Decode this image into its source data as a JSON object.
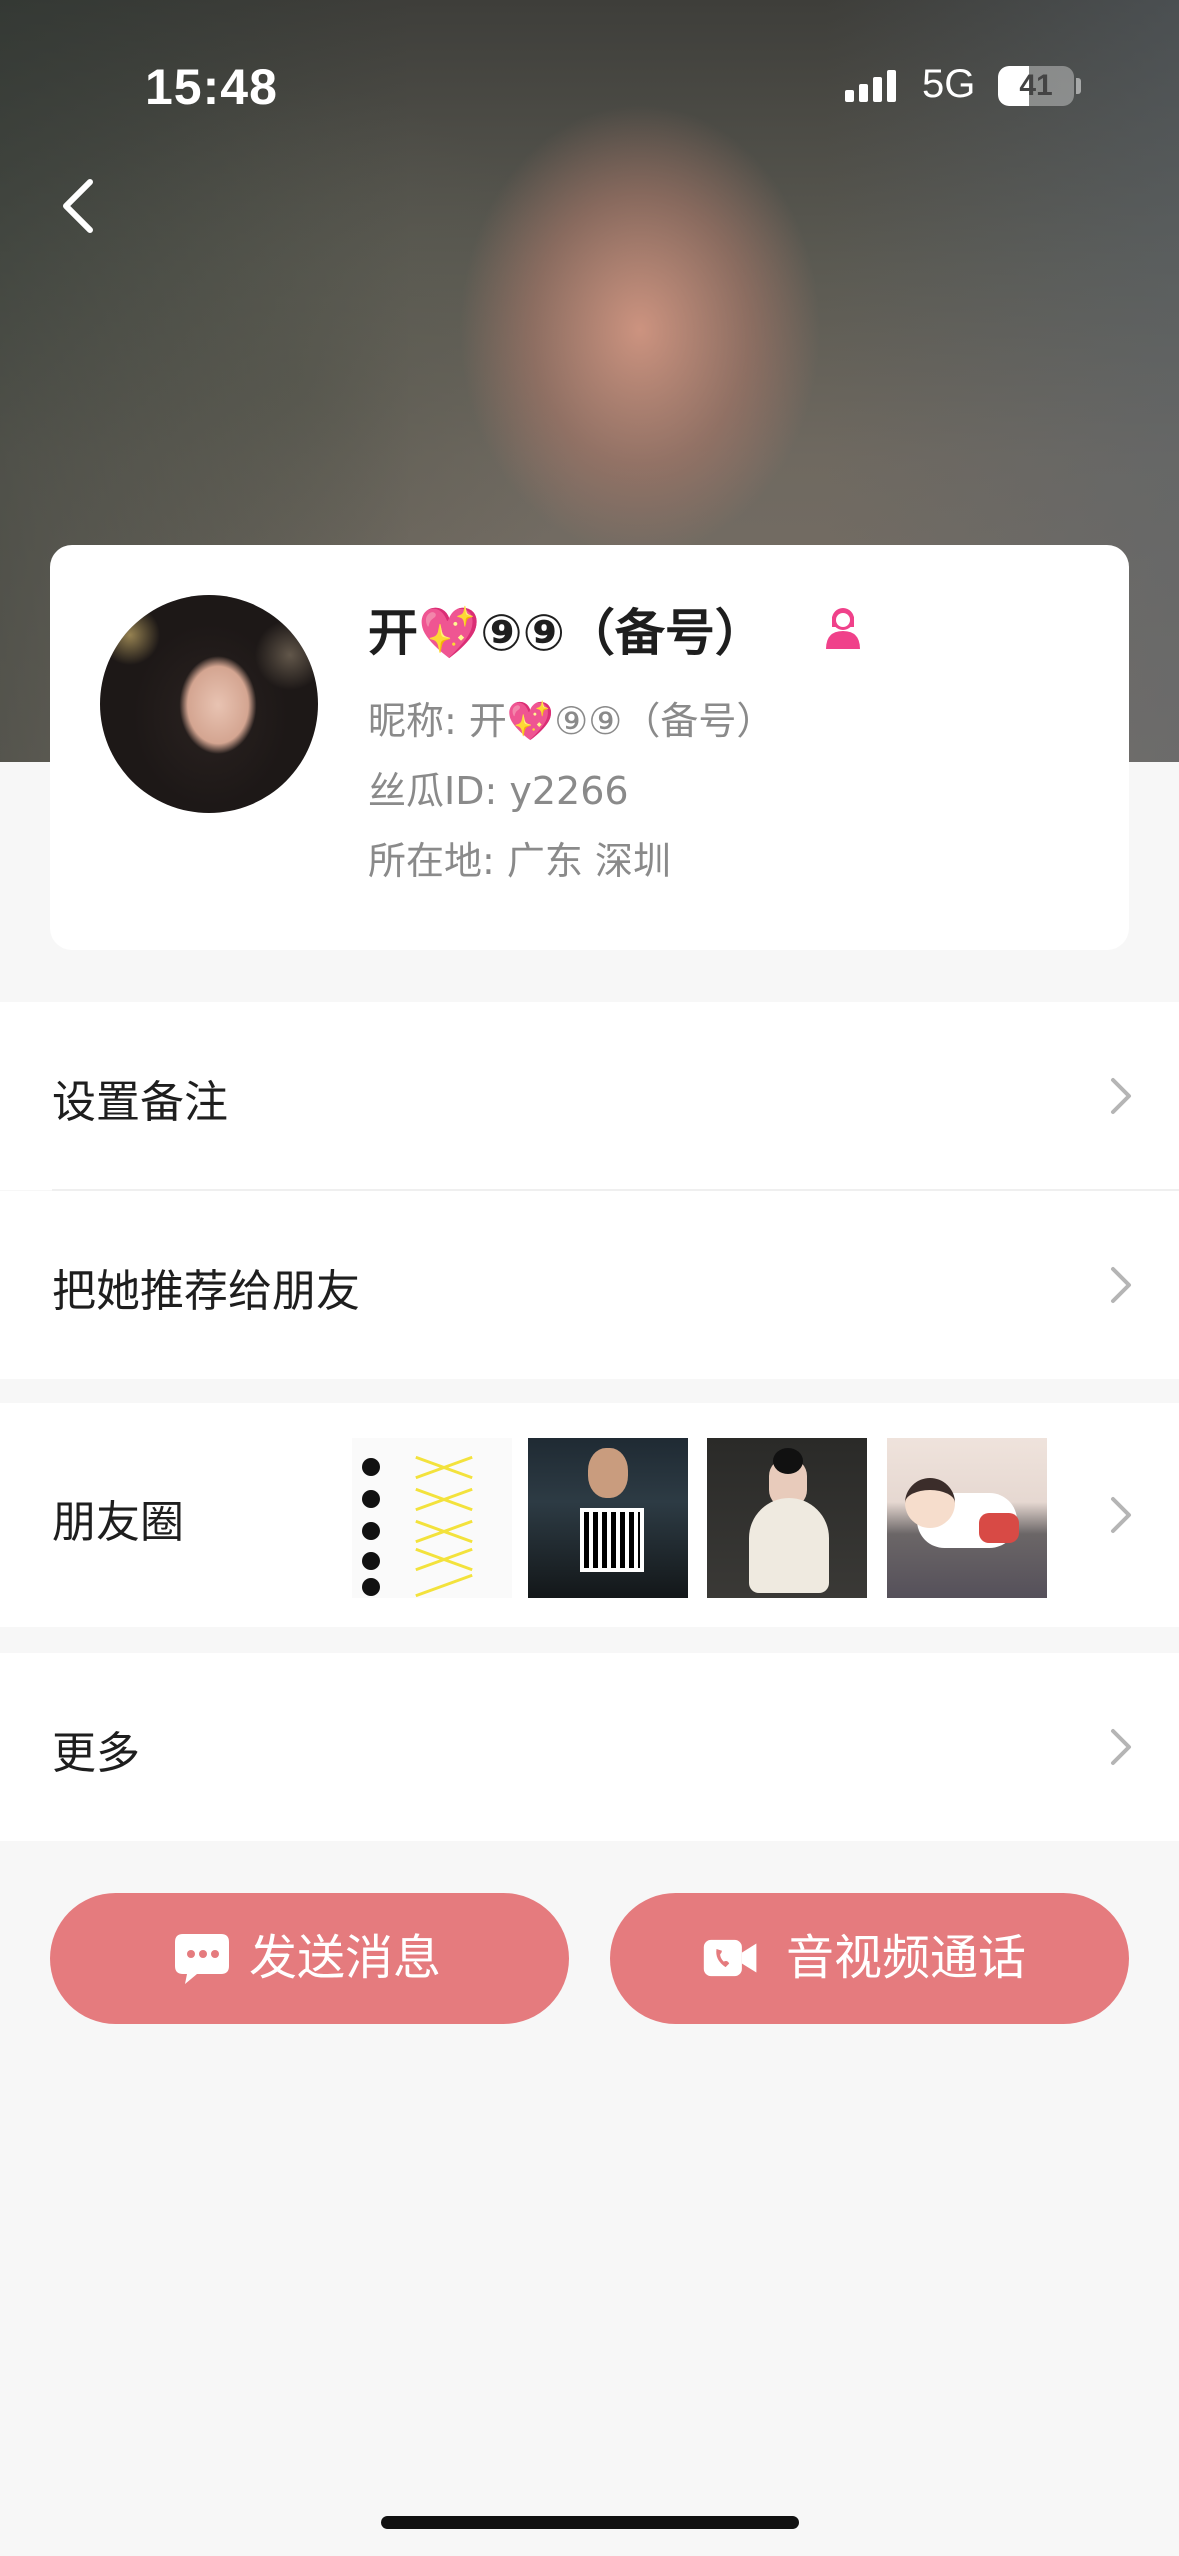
{
  "status_bar": {
    "time": "15:48",
    "network": "5G",
    "battery": "41",
    "battery_level_percent": 41
  },
  "header": {
    "back_icon": "chevron-left-icon"
  },
  "profile": {
    "name": "开💖⑨⑨（备号）",
    "gender_icon": "female-user-icon",
    "gender_color": "#f0418a",
    "nickname": "昵称: 开💖⑨⑨（备号）",
    "user_id": "丝瓜ID: y2266",
    "location": "所在地: 广东 深圳"
  },
  "menu": {
    "set_remark": "设置备注",
    "recommend": "把她推荐给朋友",
    "moments": "朋友圈",
    "more": "更多"
  },
  "actions": {
    "send_message": "发送消息",
    "video_call": "音视频通话",
    "accent_color": "#e57b7e"
  }
}
